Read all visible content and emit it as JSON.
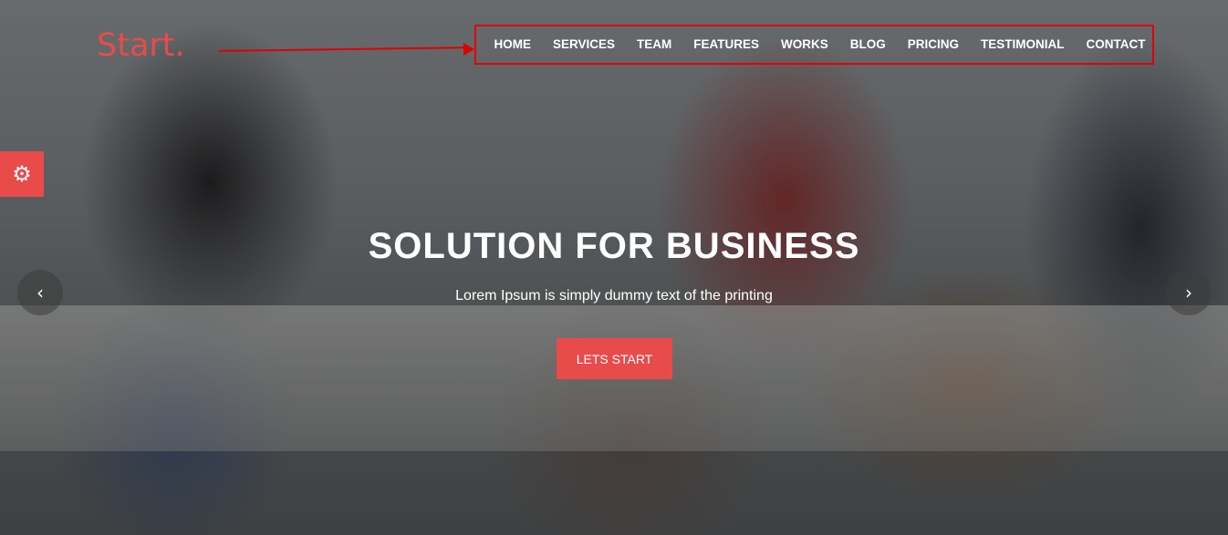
{
  "brand": {
    "logo_text": "Start."
  },
  "nav": {
    "items": [
      {
        "label": "HOME"
      },
      {
        "label": "SERVICES"
      },
      {
        "label": "TEAM"
      },
      {
        "label": "FEATURES"
      },
      {
        "label": "WORKS"
      },
      {
        "label": "BLOG"
      },
      {
        "label": "PRICING"
      },
      {
        "label": "TESTIMONIAL"
      },
      {
        "label": "CONTACT"
      }
    ]
  },
  "hero": {
    "title": "SOLUTION FOR BUSINESS",
    "subtitle": "Lorem Ipsum is simply dummy text of the printing",
    "cta_label": "LETS START",
    "prev_icon": "‹",
    "next_icon": "›"
  },
  "settings": {
    "icon": "⚙"
  },
  "colors": {
    "accent": "#e94b4b",
    "annotation": "#e00000",
    "text": "#ffffff"
  },
  "icons": {
    "settings": "gear-icon",
    "prev": "chevron-left-icon",
    "next": "chevron-right-icon"
  }
}
